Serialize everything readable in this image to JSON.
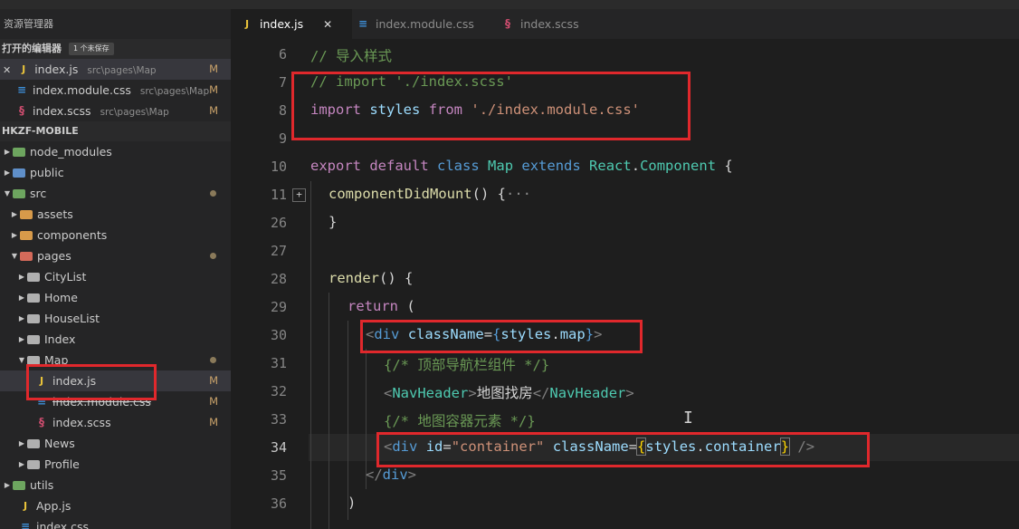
{
  "sidebar": {
    "title": "资源管理器",
    "open_editors": {
      "label": "打开的编辑器",
      "badge": "1 个未保存",
      "files": [
        {
          "close": "✕",
          "name": "index.js",
          "path": "src\\pages\\Map",
          "status": "M",
          "icon": "js-file-icon"
        },
        {
          "name": "index.module.css",
          "path": "src\\pages\\Map",
          "status": "M",
          "icon": "css-file-icon"
        },
        {
          "name": "index.scss",
          "path": "src\\pages\\Map",
          "status": "M",
          "icon": "scss-file-icon"
        }
      ]
    },
    "project": {
      "label": "HKZF-MOBILE",
      "tree": [
        {
          "name": "node_modules"
        },
        {
          "name": "public"
        },
        {
          "name": "src"
        },
        {
          "name": "assets"
        },
        {
          "name": "components"
        },
        {
          "name": "pages"
        },
        {
          "name": "CityList"
        },
        {
          "name": "Home"
        },
        {
          "name": "HouseList"
        },
        {
          "name": "Index"
        },
        {
          "name": "Map"
        },
        {
          "name": "index.js",
          "status": "M"
        },
        {
          "name": "index.module.css",
          "status": "M"
        },
        {
          "name": "index.scss",
          "status": "M"
        },
        {
          "name": "News"
        },
        {
          "name": "Profile"
        },
        {
          "name": "utils"
        },
        {
          "name": "App.js"
        },
        {
          "name": "index.css"
        }
      ]
    }
  },
  "tabs": [
    {
      "label": "index.js",
      "close": "✕",
      "icon": "js-file-icon"
    },
    {
      "label": "index.module.css",
      "icon": "css-file-icon"
    },
    {
      "label": "index.scss",
      "icon": "scss-file-icon"
    }
  ],
  "editor": {
    "line_numbers": [
      "6",
      "7",
      "8",
      "9",
      "10",
      "11",
      "26",
      "27",
      "28",
      "29",
      "30",
      "31",
      "32",
      "33",
      "34",
      "35",
      "36"
    ],
    "fold_marker": "+",
    "l6": {
      "comment": "// 导入样式"
    },
    "l7": {
      "comment": "// import './index.scss'"
    },
    "l8": {
      "import": "import",
      "styles": "styles",
      "from": "from",
      "path": "'./index.module.css'"
    },
    "l10": {
      "export": "export",
      "default": "default",
      "class": "class",
      "name": "Map",
      "extends": "extends",
      "react": "React",
      "dot": ".",
      "component": "Component",
      "brace": "{"
    },
    "l11": {
      "method": "componentDidMount",
      "parens": "()",
      "rest": "{",
      "ellipsis": "···"
    },
    "l26": {
      "brace": "}"
    },
    "l28": {
      "method": "render",
      "parens": "()",
      "brace": "{"
    },
    "l29": {
      "return": "return",
      "paren": "("
    },
    "l30": {
      "lt": "<",
      "tag": "div",
      "attr": "className",
      "eq": "=",
      "ob": "{",
      "styles": "styles",
      "dot": ".",
      "prop": "map",
      "cb": "}",
      "gt": ">"
    },
    "l31": {
      "comment": "{/* 顶部导航栏组件 */}"
    },
    "l32": {
      "lt": "<",
      "tag": "NavHeader",
      "gt": ">",
      "text": "地图找房",
      "close_lt": "</",
      "close_tag": "NavHeader",
      "close_gt": ">"
    },
    "l33": {
      "comment": "{/* 地图容器元素 */}"
    },
    "l34": {
      "lt": "<",
      "tag": "div",
      "attr1": "id",
      "eq1": "=",
      "val1": "\"container\"",
      "attr2": "className",
      "eq2": "=",
      "ob": "{",
      "styles": "styles",
      "dot": ".",
      "prop": "container",
      "cb": "}",
      "end": " />"
    },
    "l35": {
      "close": "</",
      "tag": "div",
      "gt": ">"
    },
    "l36": {
      "paren": ")"
    }
  },
  "colors": {
    "highlight_box": "#e0282c",
    "editor_bg": "#1e1e1e",
    "sidebar_bg": "#252526"
  }
}
